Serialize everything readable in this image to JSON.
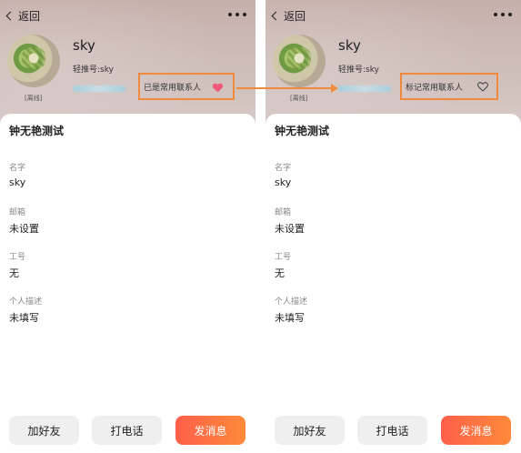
{
  "nav": {
    "back_label": "返回"
  },
  "profile": {
    "name": "sky",
    "account": "轻推号:sky",
    "status": "[离线]"
  },
  "favorite": {
    "before_label": "已是常用联系人",
    "after_label": "标记常用联系人"
  },
  "card": {
    "org": "钟无艳测试",
    "fields": [
      {
        "label": "名字",
        "value": "sky"
      },
      {
        "label": "邮箱",
        "value": "未设置"
      },
      {
        "label": "工号",
        "value": "无"
      },
      {
        "label": "个人描述",
        "value": "未填写"
      }
    ]
  },
  "actions": {
    "add_friend": "加好友",
    "call": "打电话",
    "message": "发消息"
  },
  "colors": {
    "accent_orange": "#f08a3e",
    "heart_pink": "#ef5a7b",
    "primary_gradient_start": "#ff5f4a",
    "primary_gradient_end": "#ff8a3a"
  },
  "icons": [
    "back-chevron-icon",
    "more-dots-icon",
    "heart-filled-icon",
    "heart-outline-icon",
    "arrow-right-icon"
  ]
}
